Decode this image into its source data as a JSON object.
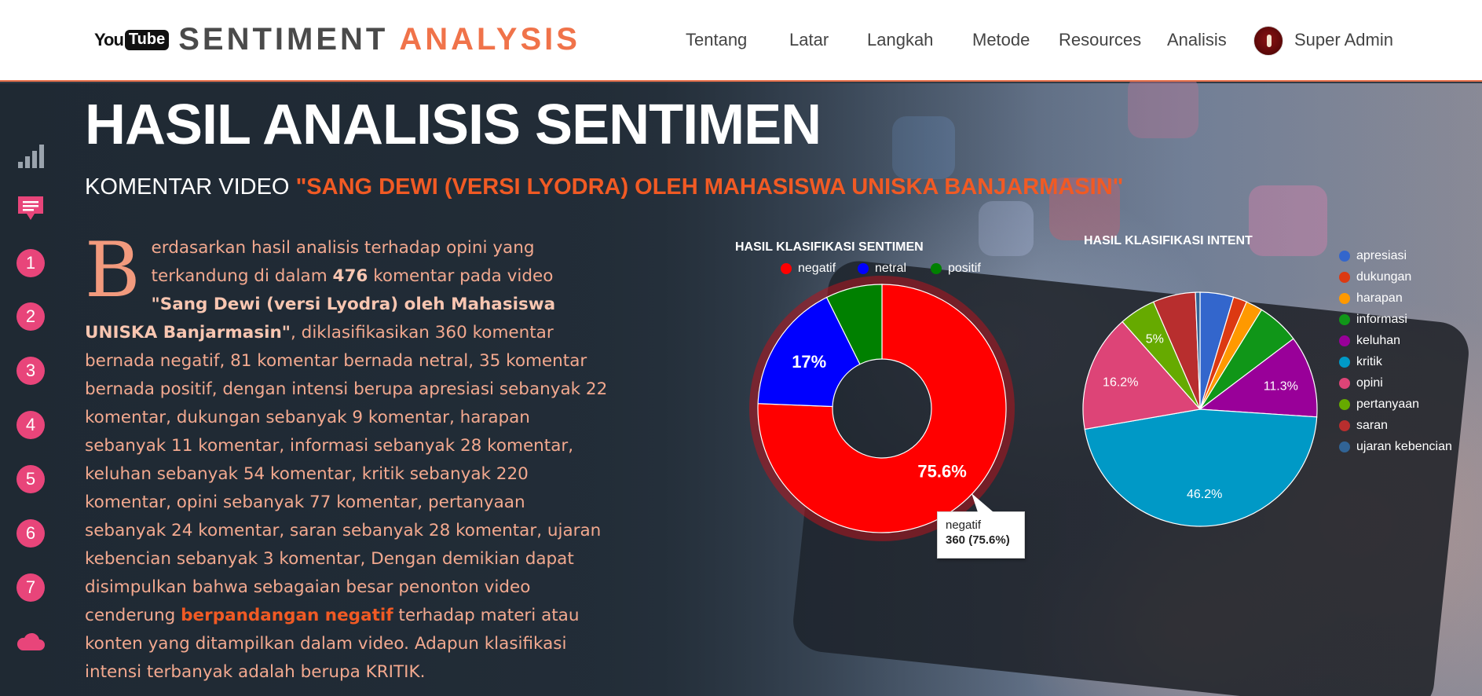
{
  "header": {
    "logo": {
      "you": "You",
      "tube": "Tube"
    },
    "brand": {
      "word1": "SENTIMENT",
      "word2": "ANALYSIS"
    },
    "nav": [
      "Tentang",
      "Latar",
      "Langkah",
      "Metode",
      "Resources",
      "Analisis"
    ],
    "user": "Super Admin"
  },
  "sidebar": {
    "numbers": [
      "1",
      "2",
      "3",
      "4",
      "5",
      "6",
      "7"
    ],
    "icons": [
      "bar-chart-icon",
      "comment-icon",
      "cloud-icon"
    ]
  },
  "main": {
    "title": "HASIL ANALISIS SENTIMEN",
    "subtitle_prefix": "KOMENTAR VIDEO ",
    "subtitle_highlight": "\"SANG DEWI (VERSI LYODRA) OLEH MAHASISWA UNISKA BANJARMASIN\"",
    "paragraph": {
      "dropcap": "B",
      "p1": "erdasarkan hasil analisis terhadap opini yang terkandung di dalam ",
      "count": "476",
      "p2": " komentar pada video ",
      "video": "\"Sang Dewi (versi Lyodra) oleh Mahasiswa UNISKA Banjarmasin\"",
      "p3": ", diklasifikasikan 360 komentar bernada negatif, 81 komentar bernada netral, 35 komentar bernada positif, dengan intensi berupa apresiasi sebanyak 22 komentar, dukungan sebanyak 9 komentar, harapan sebanyak 11 komentar, informasi sebanyak 28 komentar, keluhan sebanyak 54 komentar, kritik sebanyak 220 komentar, opini sebanyak 77 komentar, pertanyaan sebanyak 24 komentar, saran sebanyak 28 komentar, ujaran kebencian sebanyak 3 komentar, Dengan demikian dapat disimpulkan bahwa sebagaian besar penonton video cenderung ",
      "emphasis": "berpandangan negatif",
      "p4": " terhadap materi atau konten yang ditampilkan dalam video. Adapun klasifikasi intensi terbanyak adalah berupa KRITIK."
    }
  },
  "chart_data": [
    {
      "type": "pie",
      "title": "HASIL KLASIFIKASI SENTIMEN",
      "donut": true,
      "categories": [
        "negatif",
        "netral",
        "positif"
      ],
      "values": [
        360,
        81,
        35
      ],
      "colors": [
        "#ff0000",
        "#0000ff",
        "#008000"
      ],
      "slice_labels": [
        "75.6%",
        "17%",
        ""
      ],
      "legend_position": "top",
      "tooltip": {
        "label": "negatif",
        "value": "360 (75.6%)"
      }
    },
    {
      "type": "pie",
      "title": "HASIL KLASIFIKASI INTENT",
      "donut": false,
      "categories": [
        "apresiasi",
        "dukungan",
        "harapan",
        "informasi",
        "keluhan",
        "kritik",
        "opini",
        "pertanyaan",
        "saran",
        "ujaran kebencian"
      ],
      "values": [
        22,
        9,
        11,
        28,
        54,
        220,
        77,
        24,
        28,
        3
      ],
      "colors": [
        "#3366cc",
        "#dc3912",
        "#ff9900",
        "#109618",
        "#990099",
        "#0099c6",
        "#dd4477",
        "#66aa00",
        "#b82e2e",
        "#316395"
      ],
      "slice_labels": [
        "",
        "",
        "",
        "",
        "11.3%",
        "46.2%",
        "16.2%",
        "5%",
        "",
        ""
      ],
      "legend_position": "right"
    }
  ]
}
